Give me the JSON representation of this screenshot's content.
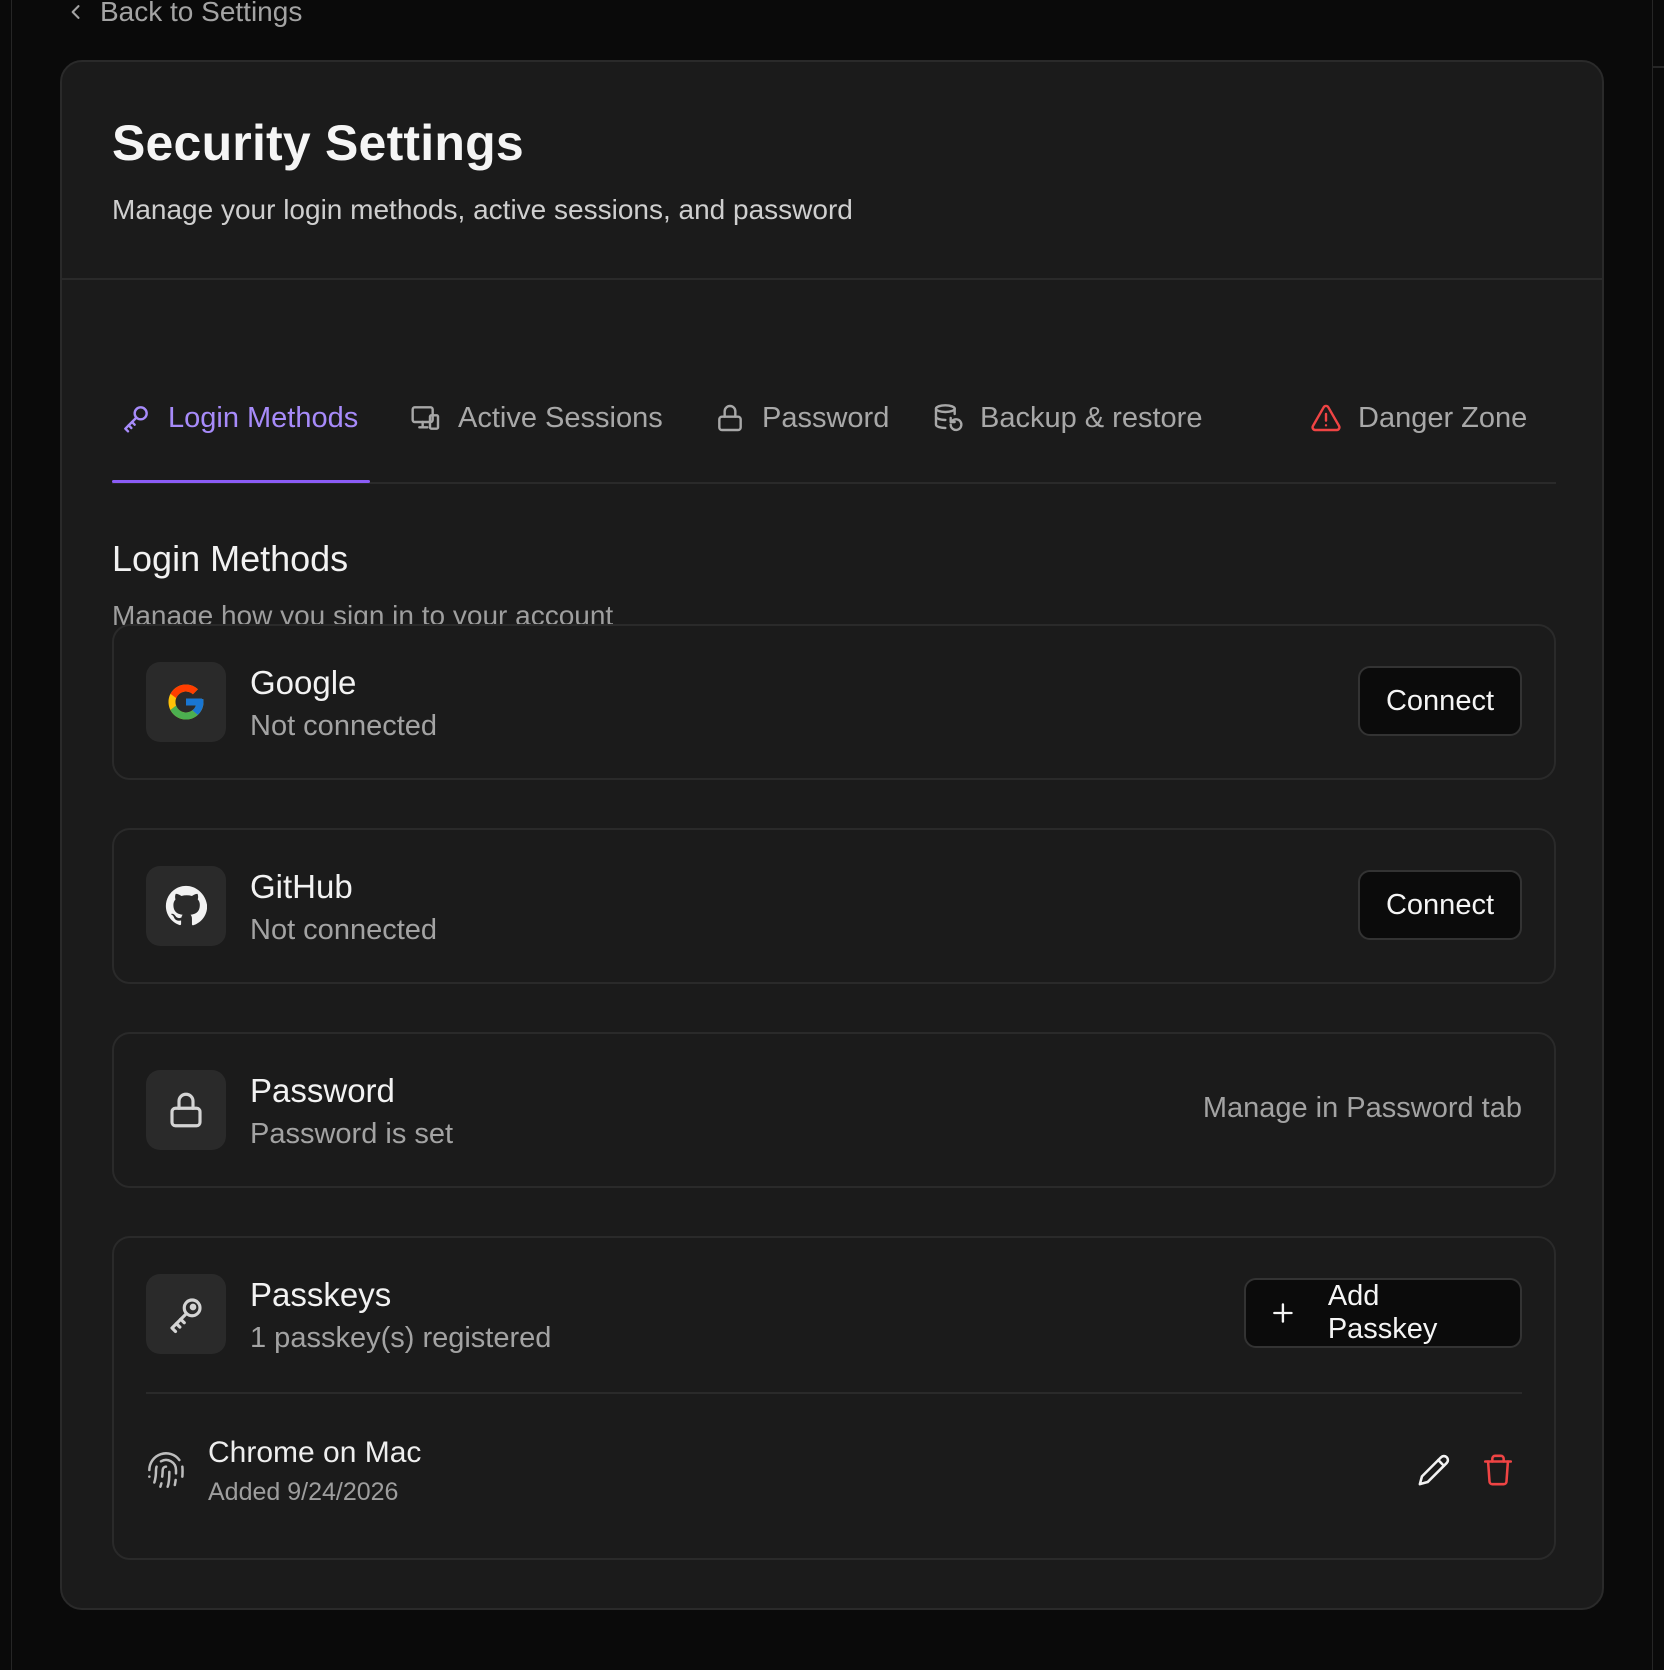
{
  "nav": {
    "back_label": "Back to Settings"
  },
  "header": {
    "title": "Security Settings",
    "subtitle": "Manage your login methods, active sessions, and password"
  },
  "tabs": [
    {
      "label": "Login Methods",
      "icon": "key-icon",
      "active": true
    },
    {
      "label": "Active Sessions",
      "icon": "devices-icon",
      "active": false
    },
    {
      "label": "Password",
      "icon": "lock-icon",
      "active": false
    },
    {
      "label": "Backup & restore",
      "icon": "database-restore-icon",
      "active": false
    },
    {
      "label": "Danger Zone",
      "icon": "warning-icon",
      "active": false
    }
  ],
  "section": {
    "title": "Login Methods",
    "subtitle": "Manage how you sign in to your account"
  },
  "methods": {
    "google": {
      "name": "Google",
      "status": "Not connected",
      "action": "Connect",
      "icon": "google-icon"
    },
    "github": {
      "name": "GitHub",
      "status": "Not connected",
      "action": "Connect",
      "icon": "github-icon"
    },
    "password": {
      "name": "Password",
      "status": "Password is set",
      "note": "Manage in Password tab",
      "icon": "lock-icon"
    },
    "passkeys": {
      "name": "Passkeys",
      "status": "1 passkey(s) registered",
      "action": "Add Passkey",
      "icon": "key-icon",
      "items": [
        {
          "name": "Chrome on Mac",
          "added": "Added 9/24/2026"
        }
      ]
    }
  },
  "colors": {
    "accent": "#a78bfa",
    "danger": "#ef4444",
    "card": "#1b1b1b",
    "background": "#0a0a0a"
  }
}
